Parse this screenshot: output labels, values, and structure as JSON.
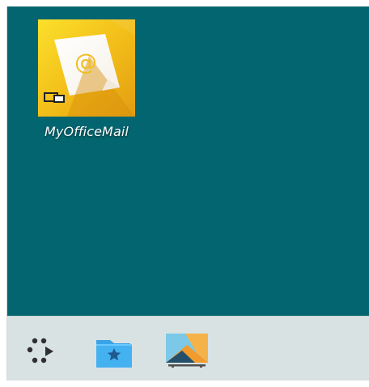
{
  "desktop": {
    "icons": [
      {
        "label": "MyOfficeMail",
        "icon": "mail-app-icon",
        "colors": {
          "background_start": "#f8d51d",
          "background_end": "#e7a113",
          "accent": "#f4c326"
        }
      }
    ],
    "background": "#02656f"
  },
  "taskbar": {
    "background": "#d8e2e3",
    "items": [
      {
        "icon": "launcher-dots-icon"
      },
      {
        "icon": "folder-star-icon"
      },
      {
        "icon": "presentation-app-icon"
      }
    ]
  }
}
